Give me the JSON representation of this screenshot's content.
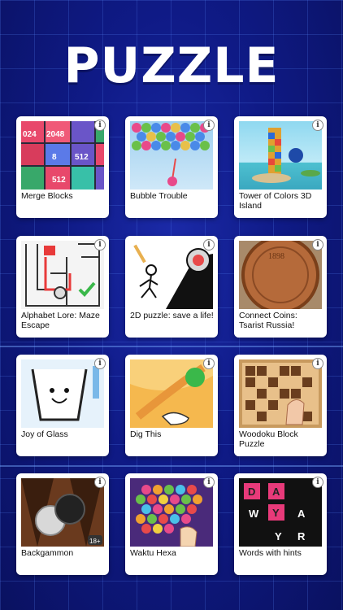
{
  "title": "PUZZLE",
  "info_glyph": "i",
  "games": [
    {
      "name": "Merge Blocks"
    },
    {
      "name": "Bubble Trouble"
    },
    {
      "name": "Tower of Colors 3D Island"
    },
    {
      "name": "Alphabet Lore: Maze Escape"
    },
    {
      "name": "2D puzzle: save a life!"
    },
    {
      "name": "Connect Coins: Tsarist Russia!"
    },
    {
      "name": "Joy of Glass"
    },
    {
      "name": "Dig This"
    },
    {
      "name": "Woodoku Block Puzzle"
    },
    {
      "name": "Backgammon"
    },
    {
      "name": "Waktu Hexa"
    },
    {
      "name": "Words with hints"
    }
  ],
  "merge_tiles": [
    "024",
    "2048",
    "512",
    "8",
    "512"
  ],
  "word_letters": [
    "D",
    "A",
    "W",
    "Y",
    "A",
    "Y",
    "R"
  ],
  "age_badge": "18+",
  "coin_text": "1898",
  "colors": {
    "background": "#0f1a86",
    "card": "#ffffff",
    "grid": "#5a8cff"
  }
}
